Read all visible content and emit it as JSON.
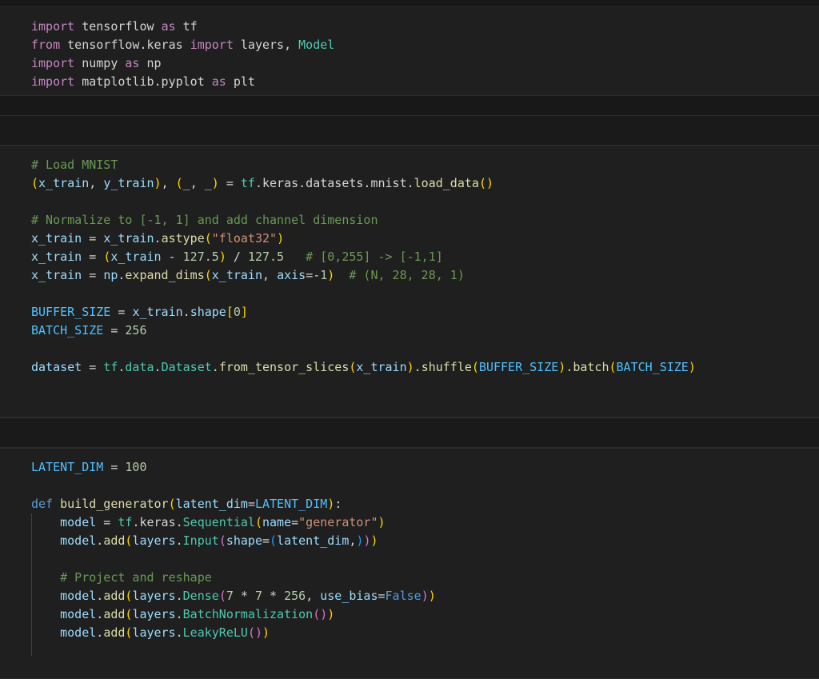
{
  "cells": [
    {
      "lines": [
        [
          [
            "import",
            "kw-imp"
          ],
          [
            " tensorflow ",
            "op"
          ],
          [
            "as",
            "kw-imp"
          ],
          [
            " tf",
            "op"
          ]
        ],
        [
          [
            "from",
            "kw-imp"
          ],
          [
            " tensorflow.keras ",
            "op"
          ],
          [
            "import",
            "kw-imp"
          ],
          [
            " layers, ",
            "op"
          ],
          [
            "Model",
            "cls"
          ]
        ],
        [
          [
            "import",
            "kw-imp"
          ],
          [
            " numpy ",
            "op"
          ],
          [
            "as",
            "kw-imp"
          ],
          [
            " np",
            "op"
          ]
        ],
        [
          [
            "import",
            "kw-imp"
          ],
          [
            " matplotlib.pyplot ",
            "op"
          ],
          [
            "as",
            "kw-imp"
          ],
          [
            " plt",
            "op"
          ]
        ]
      ]
    },
    {
      "lines": [
        [
          [
            "# Load MNIST",
            "cmt"
          ]
        ],
        [
          [
            "(",
            "b1"
          ],
          [
            "x_train",
            "var"
          ],
          [
            ", ",
            "op"
          ],
          [
            "y_train",
            "var"
          ],
          [
            ")",
            "b1"
          ],
          [
            ", ",
            "op"
          ],
          [
            "(",
            "b1"
          ],
          [
            "_",
            "var"
          ],
          [
            ", ",
            "op"
          ],
          [
            "_",
            "var"
          ],
          [
            ")",
            "b1"
          ],
          [
            " = ",
            "op"
          ],
          [
            "tf",
            "cls"
          ],
          [
            ".keras.datasets.mnist.",
            "op"
          ],
          [
            "load_data",
            "fn"
          ],
          [
            "()",
            "b1"
          ]
        ],
        [
          [
            "",
            "op"
          ]
        ],
        [
          [
            "# Normalize to [-1, 1] and add channel dimension",
            "cmt"
          ]
        ],
        [
          [
            "x_train",
            "var"
          ],
          [
            " = ",
            "op"
          ],
          [
            "x_train",
            "var"
          ],
          [
            ".",
            "op"
          ],
          [
            "astype",
            "fn"
          ],
          [
            "(",
            "b1"
          ],
          [
            "\"float32\"",
            "str"
          ],
          [
            ")",
            "b1"
          ]
        ],
        [
          [
            "x_train",
            "var"
          ],
          [
            " = ",
            "op"
          ],
          [
            "(",
            "b1"
          ],
          [
            "x_train",
            "var"
          ],
          [
            " - ",
            "op"
          ],
          [
            "127.5",
            "num"
          ],
          [
            ")",
            "b1"
          ],
          [
            " / ",
            "op"
          ],
          [
            "127.5",
            "num"
          ],
          [
            "   # [0,255] -> [-1,1]",
            "cmt"
          ]
        ],
        [
          [
            "x_train",
            "var"
          ],
          [
            " = ",
            "op"
          ],
          [
            "np",
            "var"
          ],
          [
            ".",
            "op"
          ],
          [
            "expand_dims",
            "fn"
          ],
          [
            "(",
            "b1"
          ],
          [
            "x_train",
            "var"
          ],
          [
            ", ",
            "op"
          ],
          [
            "axis",
            "var"
          ],
          [
            "=-",
            "op"
          ],
          [
            "1",
            "num"
          ],
          [
            ")",
            "b1"
          ],
          [
            "  # (N, 28, 28, 1)",
            "cmt"
          ]
        ],
        [
          [
            "",
            "op"
          ]
        ],
        [
          [
            "BUFFER_SIZE",
            "const"
          ],
          [
            " = ",
            "op"
          ],
          [
            "x_train",
            "var"
          ],
          [
            ".",
            "op"
          ],
          [
            "shape",
            "var"
          ],
          [
            "[",
            "b1"
          ],
          [
            "0",
            "num"
          ],
          [
            "]",
            "b1"
          ]
        ],
        [
          [
            "BATCH_SIZE",
            "const"
          ],
          [
            " = ",
            "op"
          ],
          [
            "256",
            "num"
          ]
        ],
        [
          [
            "",
            "op"
          ]
        ],
        [
          [
            "dataset",
            "var"
          ],
          [
            " = ",
            "op"
          ],
          [
            "tf",
            "cls"
          ],
          [
            ".",
            "op"
          ],
          [
            "data",
            "cls"
          ],
          [
            ".",
            "op"
          ],
          [
            "Dataset",
            "cls"
          ],
          [
            ".",
            "op"
          ],
          [
            "from_tensor_slices",
            "fn"
          ],
          [
            "(",
            "b1"
          ],
          [
            "x_train",
            "var"
          ],
          [
            ")",
            "b1"
          ],
          [
            ".",
            "op"
          ],
          [
            "shuffle",
            "fn"
          ],
          [
            "(",
            "b1"
          ],
          [
            "BUFFER_SIZE",
            "const"
          ],
          [
            ")",
            "b1"
          ],
          [
            ".",
            "op"
          ],
          [
            "batch",
            "fn"
          ],
          [
            "(",
            "b1"
          ],
          [
            "BATCH_SIZE",
            "const"
          ],
          [
            ")",
            "b1"
          ]
        ]
      ]
    },
    {
      "lines": [
        [
          [
            "LATENT_DIM",
            "const"
          ],
          [
            " = ",
            "op"
          ],
          [
            "100",
            "num"
          ]
        ],
        [
          [
            "",
            "op"
          ]
        ],
        [
          [
            "def",
            "kw-def"
          ],
          [
            " ",
            "op"
          ],
          [
            "build_generator",
            "fn"
          ],
          [
            "(",
            "b1"
          ],
          [
            "latent_dim",
            "var"
          ],
          [
            "=",
            "op"
          ],
          [
            "LATENT_DIM",
            "const"
          ],
          [
            ")",
            "b1"
          ],
          [
            ":",
            "op"
          ]
        ],
        [
          [
            "    ",
            "op"
          ],
          [
            "model",
            "var"
          ],
          [
            " = ",
            "op"
          ],
          [
            "tf",
            "cls"
          ],
          [
            ".keras.",
            "op"
          ],
          [
            "Sequential",
            "cls"
          ],
          [
            "(",
            "b1"
          ],
          [
            "name",
            "var"
          ],
          [
            "=",
            "op"
          ],
          [
            "\"generator\"",
            "str"
          ],
          [
            ")",
            "b1"
          ]
        ],
        [
          [
            "    ",
            "op"
          ],
          [
            "model",
            "var"
          ],
          [
            ".",
            "op"
          ],
          [
            "add",
            "fn"
          ],
          [
            "(",
            "b1"
          ],
          [
            "layers",
            "var"
          ],
          [
            ".",
            "op"
          ],
          [
            "Input",
            "cls"
          ],
          [
            "(",
            "b2"
          ],
          [
            "shape",
            "var"
          ],
          [
            "=",
            "op"
          ],
          [
            "(",
            "b3"
          ],
          [
            "latent_dim",
            "var"
          ],
          [
            ",",
            "op"
          ],
          [
            ")",
            "b3"
          ],
          [
            ")",
            "b2"
          ],
          [
            ")",
            "b1"
          ]
        ],
        [
          [
            "",
            "op"
          ]
        ],
        [
          [
            "    ",
            "op"
          ],
          [
            "# Project and reshape",
            "cmt"
          ]
        ],
        [
          [
            "    ",
            "op"
          ],
          [
            "model",
            "var"
          ],
          [
            ".",
            "op"
          ],
          [
            "add",
            "fn"
          ],
          [
            "(",
            "b1"
          ],
          [
            "layers",
            "var"
          ],
          [
            ".",
            "op"
          ],
          [
            "Dense",
            "cls"
          ],
          [
            "(",
            "b2"
          ],
          [
            "7",
            "num"
          ],
          [
            " * ",
            "op"
          ],
          [
            "7",
            "num"
          ],
          [
            " * ",
            "op"
          ],
          [
            "256",
            "num"
          ],
          [
            ", ",
            "op"
          ],
          [
            "use_bias",
            "var"
          ],
          [
            "=",
            "op"
          ],
          [
            "False",
            "kw-def"
          ],
          [
            ")",
            "b2"
          ],
          [
            ")",
            "b1"
          ]
        ],
        [
          [
            "    ",
            "op"
          ],
          [
            "model",
            "var"
          ],
          [
            ".",
            "op"
          ],
          [
            "add",
            "fn"
          ],
          [
            "(",
            "b1"
          ],
          [
            "layers",
            "var"
          ],
          [
            ".",
            "op"
          ],
          [
            "BatchNormalization",
            "cls"
          ],
          [
            "()",
            "b2"
          ],
          [
            ")",
            "b1"
          ]
        ],
        [
          [
            "    ",
            "op"
          ],
          [
            "model",
            "var"
          ],
          [
            ".",
            "op"
          ],
          [
            "add",
            "fn"
          ],
          [
            "(",
            "b1"
          ],
          [
            "layers",
            "var"
          ],
          [
            ".",
            "op"
          ],
          [
            "LeakyReLU",
            "cls"
          ],
          [
            "()",
            "b2"
          ],
          [
            ")",
            "b1"
          ]
        ]
      ]
    }
  ],
  "colors": {
    "background": "#181818",
    "cell_background": "#1f1f1f",
    "keyword": "#c586c0",
    "comment": "#6a9955",
    "string": "#ce9178",
    "number": "#b5cea8"
  }
}
